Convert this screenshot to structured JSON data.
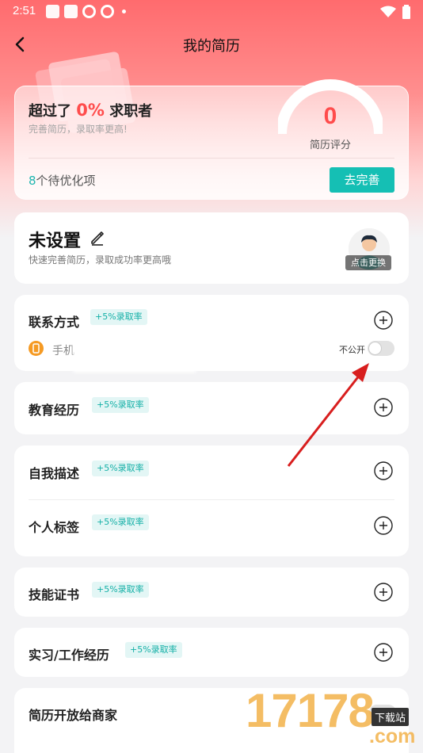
{
  "status_bar": {
    "time": "2:51"
  },
  "nav": {
    "title": "我的简历"
  },
  "score_card": {
    "exceeded_prefix": "超过了",
    "exceeded_percent": "0%",
    "exceeded_suffix": "求职者",
    "subtitle": "完善简历，录取率更高!",
    "score": "0",
    "score_label": "简历评分",
    "pending_count": "8",
    "pending_text": "个待优化项",
    "improve_button": "去完善"
  },
  "profile": {
    "name": "未设置",
    "subtitle": "快速完善简历，录取成功率更高哦",
    "avatar_caption": "点击更换"
  },
  "sections": {
    "contact": {
      "title": "联系方式",
      "badge": "+5%录取率",
      "phone_label": "手机",
      "private_label": "不公开"
    },
    "education": {
      "title": "教育经历",
      "badge": "+5%录取率"
    },
    "self_desc": {
      "title": "自我描述",
      "badge": "+5%录取率"
    },
    "tags": {
      "title": "个人标签",
      "badge": "+5%录取率"
    },
    "skills": {
      "title": "技能证书",
      "badge": "+5%录取率"
    },
    "work": {
      "title": "实习/工作经历",
      "badge": "+5%录取率"
    },
    "open": {
      "title": "简历开放给商家"
    }
  },
  "watermark": {
    "number": "17178",
    "tag": "下载站",
    "suffix": ".com"
  },
  "colors": {
    "accent": "#15bfb4",
    "score": "#ff4c4c",
    "header": "#ff6b6e"
  }
}
